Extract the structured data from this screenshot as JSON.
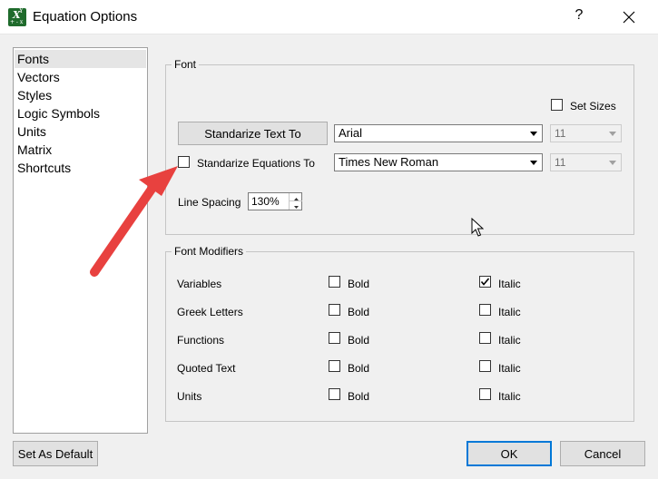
{
  "window": {
    "title": "Equation Options",
    "help_label": "?",
    "app_icon": {
      "x": "X",
      "sup": "Y",
      "sub": "+ - x"
    }
  },
  "sidebar": {
    "items": [
      {
        "label": "Fonts",
        "selected": true
      },
      {
        "label": "Vectors"
      },
      {
        "label": "Styles"
      },
      {
        "label": "Logic Symbols"
      },
      {
        "label": "Units"
      },
      {
        "label": "Matrix"
      },
      {
        "label": "Shortcuts"
      }
    ]
  },
  "font_group": {
    "caption": "Font",
    "set_sizes_label": "Set Sizes",
    "set_sizes_checked": false,
    "standardize_text_button": "Standarize Text To",
    "text_font": "Arial",
    "text_size": "11",
    "standardize_equations_label": "Standarize Equations To",
    "standardize_equations_checked": false,
    "equation_font": "Times New Roman",
    "equation_size": "11",
    "line_spacing_label": "Line Spacing",
    "line_spacing_value": "130%"
  },
  "modifiers_group": {
    "caption": "Font Modifiers",
    "bold_label": "Bold",
    "italic_label": "Italic",
    "rows": [
      {
        "name": "Variables",
        "bold": false,
        "italic": true
      },
      {
        "name": "Greek Letters",
        "bold": false,
        "italic": false
      },
      {
        "name": "Functions",
        "bold": false,
        "italic": false
      },
      {
        "name": "Quoted Text",
        "bold": false,
        "italic": false
      },
      {
        "name": "Units",
        "bold": false,
        "italic": false
      }
    ]
  },
  "footer": {
    "set_default_label": "Set As Default",
    "ok_label": "OK",
    "cancel_label": "Cancel"
  },
  "colors": {
    "annotation_arrow": "#e8413f",
    "default_button_border": "#0078d7",
    "app_icon_bg": "#1f6b2c"
  }
}
